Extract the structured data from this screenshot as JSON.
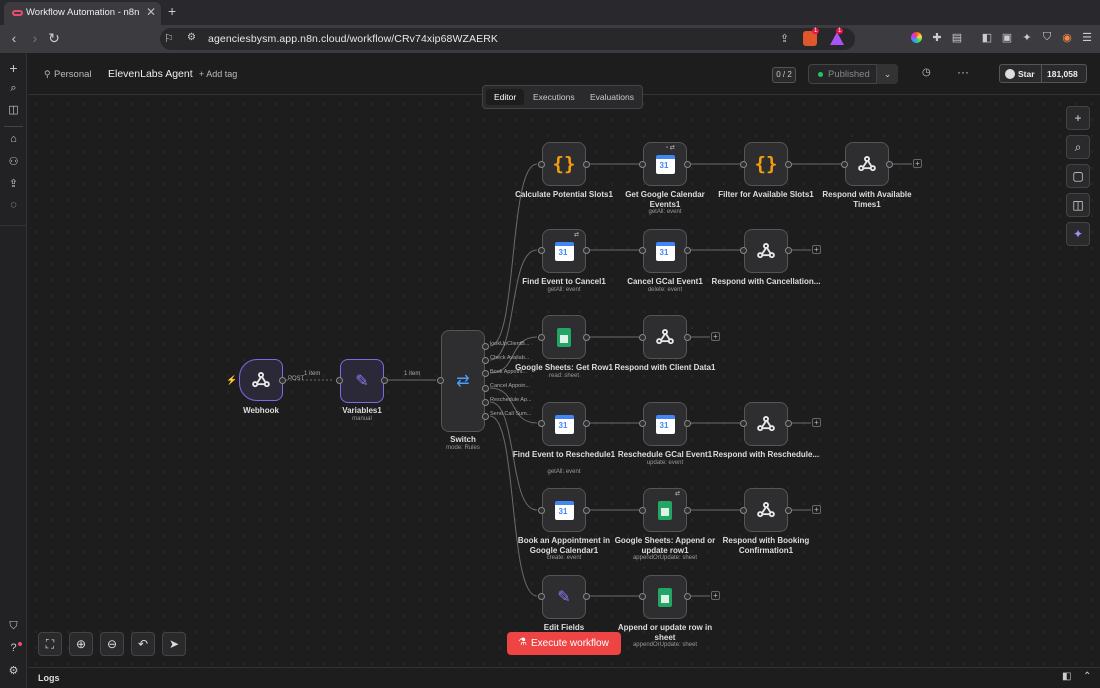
{
  "browser": {
    "tab_title": "Workflow Automation - n8n",
    "tab_close": "✕",
    "new_tab": "+",
    "url": "agenciesbysm.app.n8n.cloud/workflow/CRv74xip68WZAERK",
    "brave_badge": "1",
    "rewards_badge": "1"
  },
  "header": {
    "owner": "Personal",
    "workflow_name": "ElevenLabs Agent",
    "add_tag": "+ Add tag",
    "counter": "0 / 2",
    "published": "Published",
    "github_star": "Star",
    "github_count": "181,058"
  },
  "tabs": {
    "editor": "Editor",
    "executions": "Executions",
    "evaluations": "Evaluations"
  },
  "nodes": {
    "webhook": {
      "label": "Webhook"
    },
    "variables": {
      "label": "Variables1",
      "sub": "manual"
    },
    "switch": {
      "label": "Switch",
      "sub": "mode: Rules"
    },
    "calc_slots": {
      "label": "Calculate Potential Slots1"
    },
    "get_gcal": {
      "label": "Get Google Calendar Events1",
      "sub": "getAll: event"
    },
    "filter_slots": {
      "label": "Filter for Available Slots1"
    },
    "respond_times": {
      "label": "Respond with Available Times1"
    },
    "find_cancel": {
      "label": "Find Event to Cancel1",
      "sub": "getAll: event"
    },
    "cancel_gcal": {
      "label": "Cancel GCal Event1",
      "sub": "delete: event"
    },
    "respond_cancel": {
      "label": "Respond with Cancellation..."
    },
    "sheets_get": {
      "label": "Google Sheets: Get Row1",
      "sub": "read: sheet"
    },
    "respond_client": {
      "label": "Respond with Client Data1"
    },
    "find_resched": {
      "label": "Find Event to Reschedule1",
      "sub": "getAll: event"
    },
    "resched_gcal": {
      "label": "Reschedule GCal Event1",
      "sub": "update: event"
    },
    "respond_resched": {
      "label": "Respond with Reschedule..."
    },
    "book_appt": {
      "label": "Book an Appointment in Google Calendar1",
      "sub": "create: event"
    },
    "sheets_append": {
      "label": "Google Sheets: Append or update row1",
      "sub": "appendOrUpdate: sheet"
    },
    "respond_booking": {
      "label": "Respond with Booking Confirmation1"
    },
    "edit_fields": {
      "label": "Edit Fields"
    },
    "append_row": {
      "label": "Append or update row in sheet",
      "sub": "appendOrUpdate: sheet"
    }
  },
  "edges": {
    "post": "POST",
    "item1": "1 item",
    "item2": "1 item"
  },
  "switch_outputs": [
    "lookUpClientB...",
    "Check Availab...",
    "Book Appoint...",
    "Cancel Appoin...",
    "Reschedule Ap...",
    "Send Call Sum..."
  ],
  "execute_button": "Execute workflow",
  "logs_label": "Logs",
  "colors": {
    "accent": "#ea4b71",
    "execute": "#ef4444",
    "node_border": "#555555",
    "selected": "#7c6ae6"
  }
}
